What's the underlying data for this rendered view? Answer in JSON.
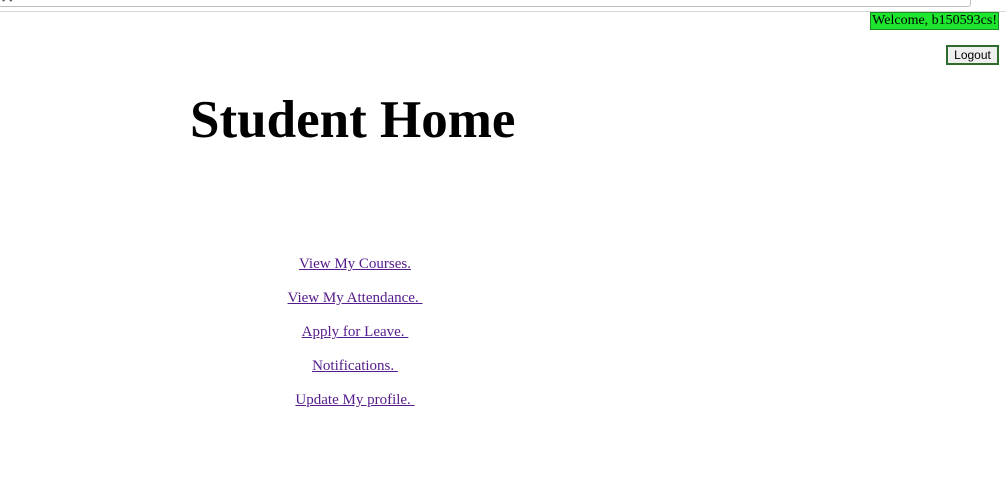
{
  "header": {
    "welcome_text": "Welcome, b150593cs!",
    "logout_label": "Logout"
  },
  "main": {
    "page_title": "Student Home",
    "links": [
      {
        "label": "View My Courses."
      },
      {
        "label": "View My Attendance. "
      },
      {
        "label": "Apply for Leave. "
      },
      {
        "label": "Notifications. "
      },
      {
        "label": "Update My profile. "
      }
    ]
  },
  "colors": {
    "welcome_bg": "#1ee62e",
    "link": "#551a8b",
    "background": "#ffffff"
  }
}
